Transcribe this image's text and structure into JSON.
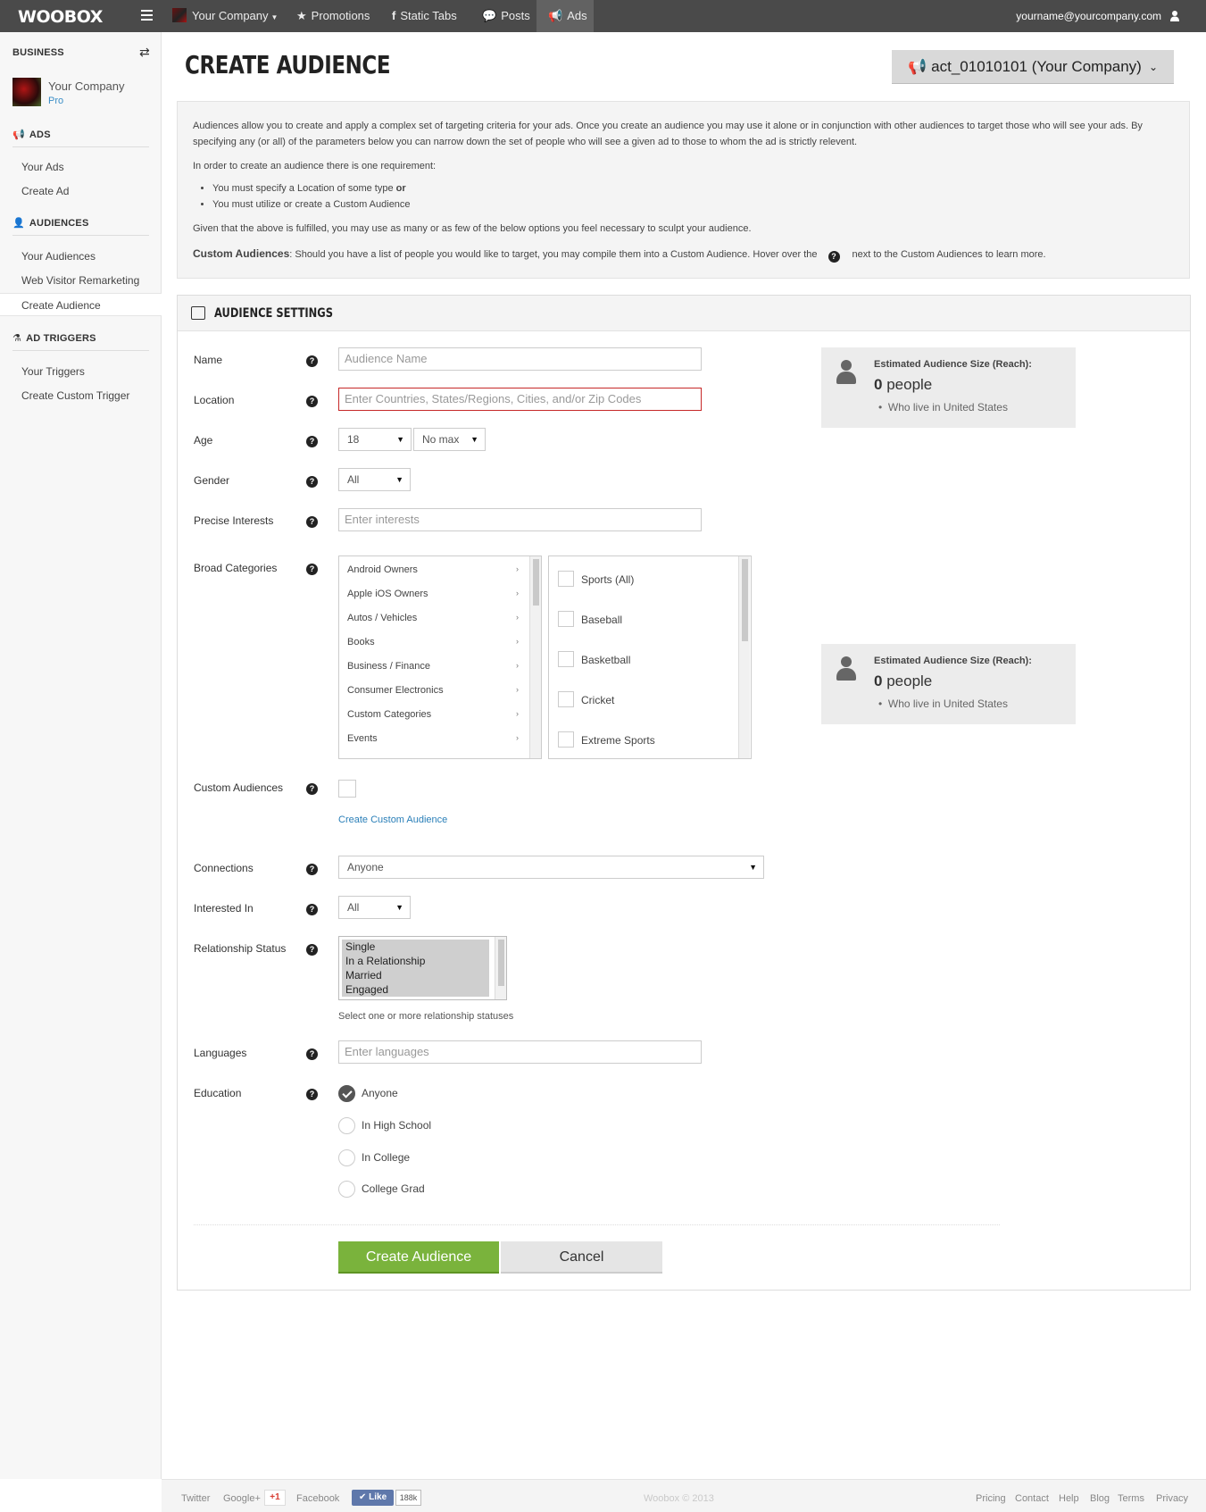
{
  "nav": {
    "logo": "WOOBOX",
    "company": "Your Company",
    "items": [
      "Promotions",
      "Static Tabs",
      "Posts",
      "Ads"
    ],
    "user_email": "yourname@yourcompany.com"
  },
  "sidebar": {
    "business_heading": "BUSINESS",
    "company_name": "Your Company",
    "plan": "Pro",
    "ads_heading": "ADS",
    "ads_links": [
      "Your Ads",
      "Create Ad"
    ],
    "audiences_heading": "AUDIENCES",
    "audiences_links": [
      "Your Audiences",
      "Web Visitor Remarketing",
      "Create Audience"
    ],
    "triggers_heading": "AD TRIGGERS",
    "triggers_links": [
      "Your Triggers",
      "Create Custom Trigger"
    ]
  },
  "header": {
    "title": "CREATE AUDIENCE",
    "account_id": "act_01010101",
    "account_name": "(Your Company)"
  },
  "info": {
    "para1": "Audiences allow you to create and apply a complex set of targeting criteria for your ads. Once you create an audience you may use it alone or in conjunction with other audiences to target those who will see your ads. By specifying any (or all) of the parameters below you can narrow down the set of people who will see a given ad to those to whom the ad is strictly relevent.",
    "para2": "In order to create an audience there is one requirement:",
    "bullet1": "You must specify a Location of some type",
    "bullet1_or": "or",
    "bullet2": "You must utilize or create a Custom Audience",
    "para3": "Given that the above is fulfilled, you may use as many or as few of the below options you feel necessary to sculpt your audience.",
    "custom_label": "Custom Audiences",
    "custom_text_a": ": Should you have a list of people you would like to target, you may compile them into a Custom Audience. Hover over the",
    "custom_text_b": "next to the Custom Audiences to learn more."
  },
  "settings": {
    "title": "AUDIENCE SETTINGS",
    "labels": {
      "name": "Name",
      "location": "Location",
      "age": "Age",
      "gender": "Gender",
      "precise": "Precise Interests",
      "broad": "Broad Categories",
      "custom": "Custom Audiences",
      "connections": "Connections",
      "interested": "Interested In",
      "relationship": "Relationship Status",
      "languages": "Languages",
      "education": "Education"
    },
    "placeholders": {
      "name": "Audience Name",
      "location": "Enter Countries, States/Regions, Cities, and/or Zip Codes",
      "precise": "Enter interests",
      "languages": "Enter languages"
    },
    "age_min": "18",
    "age_max": "No max",
    "gender": "All",
    "categories": [
      "Android Owners",
      "Apple iOS Owners",
      "Autos / Vehicles",
      "Books",
      "Business / Finance",
      "Consumer Electronics",
      "Custom Categories",
      "Events"
    ],
    "subcategories": [
      "Sports (All)",
      "Baseball",
      "Basketball",
      "Cricket",
      "Extreme Sports"
    ],
    "create_custom_link": "Create Custom Audience",
    "connections": "Anyone",
    "interested_in": "All",
    "relationship_options": [
      "Single",
      "In a Relationship",
      "Married",
      "Engaged"
    ],
    "relationship_note": "Select one or more relationship statuses",
    "education_options": [
      "Anyone",
      "In High School",
      "In College",
      "College Grad"
    ],
    "create_button": "Create Audience",
    "cancel_button": "Cancel"
  },
  "reach": {
    "title": "Estimated Audience Size (Reach):",
    "count": "0",
    "unit": "people",
    "location": "Who live in United States"
  },
  "footer": {
    "links_left": [
      "Twitter",
      "Google+",
      "Facebook"
    ],
    "gplus": "+1",
    "like": "Like",
    "like_count": "188k",
    "copyright": "Woobox © 2013",
    "links_right": [
      "Pricing",
      "Contact",
      "Help",
      "Blog",
      "Terms",
      "Privacy"
    ]
  }
}
